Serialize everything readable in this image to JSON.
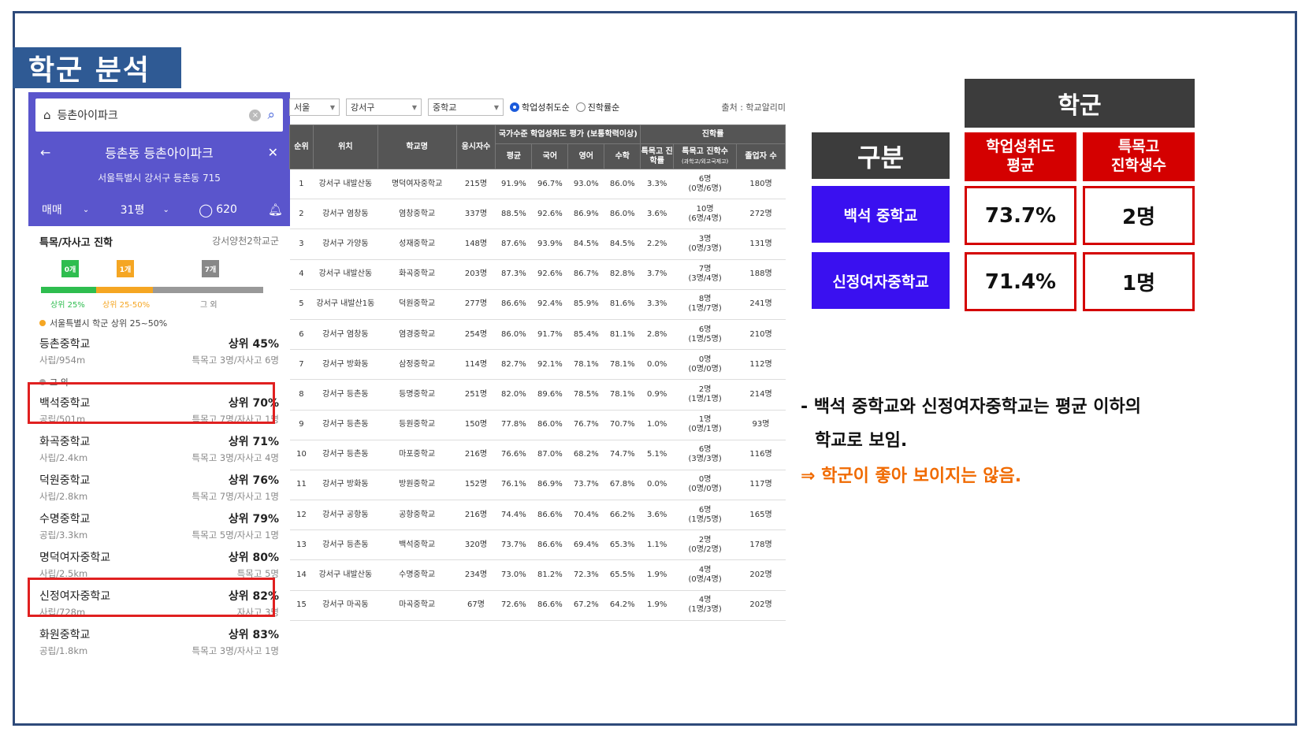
{
  "slide_title": "학군 분석",
  "phone": {
    "search_text": "등촌아이파크",
    "clear_icon": "×",
    "nav_title": "등촌동 등촌아이파크",
    "address": "서울특별시 강서구 등촌동 715",
    "deal_type": "매매",
    "size": "31평",
    "comments": "620",
    "section_title": "특목/자사고 진학",
    "district": "강서양천2학교군",
    "flags": [
      "0개",
      "1개",
      "7개"
    ],
    "bar_labels": [
      "상위 25%",
      "상위 25-50%",
      "그 외"
    ],
    "group1_label": "서울특별시 학군 상위 25~50%",
    "group2_label": "그 외",
    "schools_group1": [
      {
        "name": "등촌중학교",
        "rank": "상위 45%",
        "info": "사립/954m",
        "stat": "특목고 3명/자사고 6명"
      }
    ],
    "schools_group2": [
      {
        "name": "백석중학교",
        "rank": "상위 70%",
        "info": "공립/501m",
        "stat": "특목고 7명/자사고 1명"
      },
      {
        "name": "화곡중학교",
        "rank": "상위 71%",
        "info": "사립/2.4km",
        "stat": "특목고 3명/자사고 4명"
      },
      {
        "name": "덕원중학교",
        "rank": "상위 76%",
        "info": "사립/2.8km",
        "stat": "특목고 7명/자사고 1명"
      },
      {
        "name": "수명중학교",
        "rank": "상위 79%",
        "info": "공립/3.3km",
        "stat": "특목고 5명/자사고 1명"
      },
      {
        "name": "명덕여자중학교",
        "rank": "상위 80%",
        "info": "사립/2.5km",
        "stat": "특목고 5명"
      },
      {
        "name": "신정여자중학교",
        "rank": "상위 82%",
        "info": "사립/728m",
        "stat": "자사고 3명"
      },
      {
        "name": "화원중학교",
        "rank": "상위 83%",
        "info": "공립/1.8km",
        "stat": "특목고 3명/자사고 1명"
      }
    ]
  },
  "filters": {
    "city": "서울",
    "district": "강서구",
    "level": "중학교",
    "radio1": "학업성취도순",
    "radio2": "진학률순",
    "source": "출처 : 학교알리미"
  },
  "table": {
    "group_header_1": "국가수준 학업성취도 평가 (보통학력이상)",
    "group_header_2": "진학률",
    "headers": [
      "순위",
      "위치",
      "학교명",
      "응시자수",
      "평균",
      "국어",
      "영어",
      "수학",
      "특목고 진학률",
      "특목고 진학수",
      "(과학고/외고국제고)",
      "졸업자 수"
    ],
    "rows": [
      [
        "1",
        "강서구 내발산동",
        "명덕여자중학교",
        "215명",
        "91.9%",
        "96.7%",
        "93.0%",
        "86.0%",
        "3.3%",
        "6명",
        "(0명/6명)",
        "180명"
      ],
      [
        "2",
        "강서구 염창동",
        "염창중학교",
        "337명",
        "88.5%",
        "92.6%",
        "86.9%",
        "86.0%",
        "3.6%",
        "10명",
        "(6명/4명)",
        "272명"
      ],
      [
        "3",
        "강서구 가양동",
        "성재중학교",
        "148명",
        "87.6%",
        "93.9%",
        "84.5%",
        "84.5%",
        "2.2%",
        "3명",
        "(0명/3명)",
        "131명"
      ],
      [
        "4",
        "강서구 내발산동",
        "화곡중학교",
        "203명",
        "87.3%",
        "92.6%",
        "86.7%",
        "82.8%",
        "3.7%",
        "7명",
        "(3명/4명)",
        "188명"
      ],
      [
        "5",
        "강서구 내발산1동",
        "덕원중학교",
        "277명",
        "86.6%",
        "92.4%",
        "85.9%",
        "81.6%",
        "3.3%",
        "8명",
        "(1명/7명)",
        "241명"
      ],
      [
        "6",
        "강서구 염창동",
        "염경중학교",
        "254명",
        "86.0%",
        "91.7%",
        "85.4%",
        "81.1%",
        "2.8%",
        "6명",
        "(1명/5명)",
        "210명"
      ],
      [
        "7",
        "강서구 방화동",
        "삼정중학교",
        "114명",
        "82.7%",
        "92.1%",
        "78.1%",
        "78.1%",
        "0.0%",
        "0명",
        "(0명/0명)",
        "112명"
      ],
      [
        "8",
        "강서구 등촌동",
        "등명중학교",
        "251명",
        "82.0%",
        "89.6%",
        "78.5%",
        "78.1%",
        "0.9%",
        "2명",
        "(1명/1명)",
        "214명"
      ],
      [
        "9",
        "강서구 등촌동",
        "등원중학교",
        "150명",
        "77.8%",
        "86.0%",
        "76.7%",
        "70.7%",
        "1.0%",
        "1명",
        "(0명/1명)",
        "93명"
      ],
      [
        "10",
        "강서구 등촌동",
        "마포중학교",
        "216명",
        "76.6%",
        "87.0%",
        "68.2%",
        "74.7%",
        "5.1%",
        "6명",
        "(3명/3명)",
        "116명"
      ],
      [
        "11",
        "강서구 방화동",
        "방원중학교",
        "152명",
        "76.1%",
        "86.9%",
        "73.7%",
        "67.8%",
        "0.0%",
        "0명",
        "(0명/0명)",
        "117명"
      ],
      [
        "12",
        "강서구 공항동",
        "공항중학교",
        "216명",
        "74.4%",
        "86.6%",
        "70.4%",
        "66.2%",
        "3.6%",
        "6명",
        "(1명/5명)",
        "165명"
      ],
      [
        "13",
        "강서구 등촌동",
        "백석중학교",
        "320명",
        "73.7%",
        "86.6%",
        "69.4%",
        "65.3%",
        "1.1%",
        "2명",
        "(0명/2명)",
        "178명"
      ],
      [
        "14",
        "강서구 내발산동",
        "수명중학교",
        "234명",
        "73.0%",
        "81.2%",
        "72.3%",
        "65.5%",
        "1.9%",
        "4명",
        "(0명/4명)",
        "202명"
      ],
      [
        "15",
        "강서구 마곡동",
        "마곡중학교",
        "67명",
        "72.6%",
        "86.6%",
        "67.2%",
        "64.2%",
        "1.9%",
        "4명",
        "(1명/3명)",
        "202명"
      ]
    ]
  },
  "summary": {
    "top_header": "학군",
    "col0": "구분",
    "col1_line1": "학업성취도",
    "col1_line2": "평균",
    "col2_line1": "특목고",
    "col2_line2": "진학생수",
    "row1": {
      "name": "백석 중학교",
      "avg": "73.7%",
      "count": "2명"
    },
    "row2": {
      "name": "신정여자중학교",
      "avg": "71.4%",
      "count": "1명"
    },
    "note1": "- 백석 중학교와 신정여자중학교는 평균 이하의",
    "note2": "학교로 보임.",
    "note3": "⇒ 학군이 좋아 보이지는 않음."
  },
  "colors": {
    "frame": "#2e4a7a",
    "title_bg": "#2f5a94",
    "phone_header": "#5a55cc",
    "accent_red": "#d40000",
    "accent_blue": "#3a10f0",
    "note_orange": "#f06a00"
  }
}
